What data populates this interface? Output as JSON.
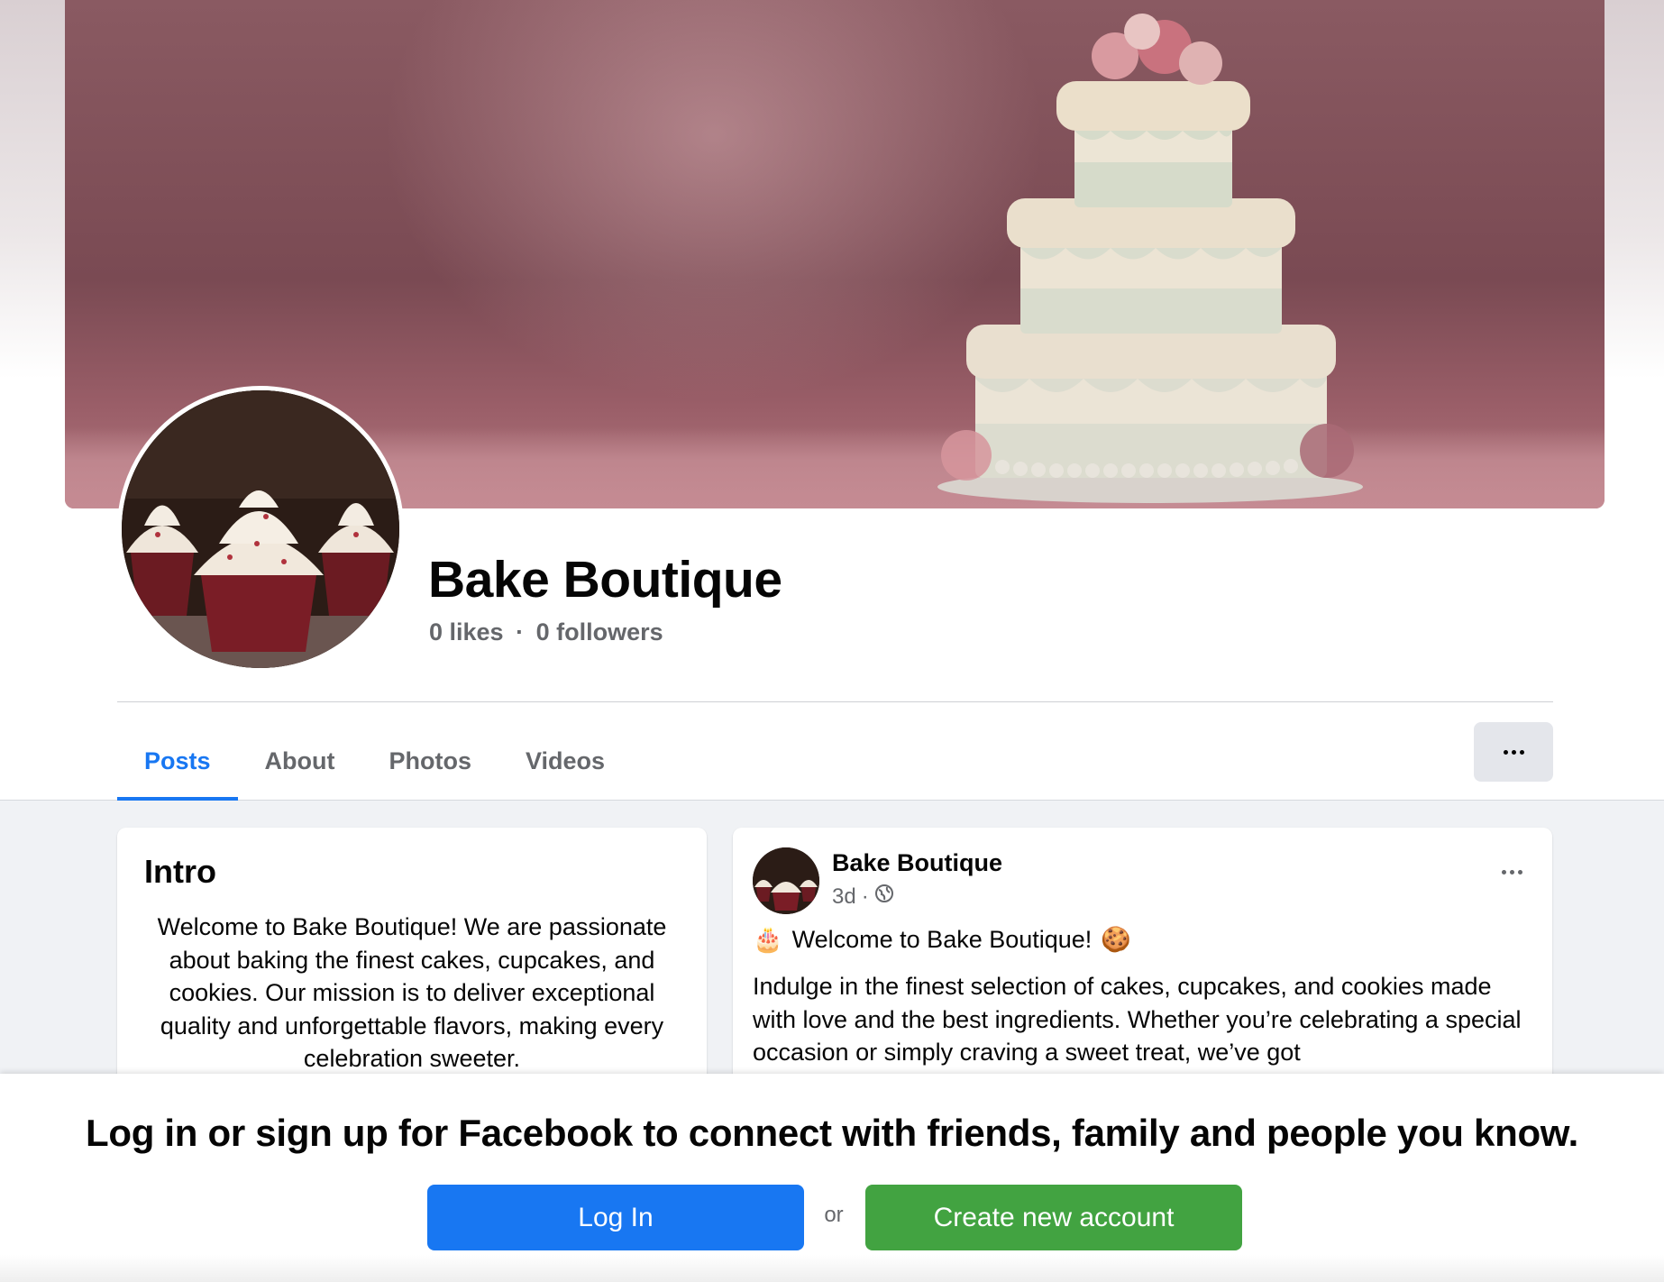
{
  "page": {
    "name": "Bake Boutique",
    "likes": "0 likes",
    "separator": "·",
    "followers": "0 followers"
  },
  "tabs": [
    {
      "label": "Posts",
      "active": true
    },
    {
      "label": "About",
      "active": false
    },
    {
      "label": "Photos",
      "active": false
    },
    {
      "label": "Videos",
      "active": false
    }
  ],
  "intro": {
    "title": "Intro",
    "text": "Welcome to Bake Boutique! We are passionate about baking the finest cakes, cupcakes, and cookies. Our mission is to deliver exceptional quality and unforgettable flavors, making every celebration sweeter."
  },
  "post": {
    "author": "Bake Boutique",
    "time": "3d",
    "meta_separator": "·",
    "headline_emoji_start": "🎂",
    "headline": "Welcome to Bake Boutique!",
    "headline_emoji_end": "🍪",
    "body": "Indulge in the finest selection of cakes, cupcakes, and cookies made with love and the best ingredients. Whether you’re celebrating a special occasion or simply craving a sweet treat, we’ve got"
  },
  "login_banner": {
    "heading": "Log in or sign up for Facebook to connect with friends, family and people you know.",
    "login_label": "Log In",
    "or_label": "or",
    "create_label": "Create new account"
  },
  "colors": {
    "accent": "#1877f2",
    "create_green": "#42a341",
    "secondary_text": "#65676b"
  },
  "icons": {
    "more": "more-horizontal-icon",
    "privacy": "globe-icon"
  }
}
